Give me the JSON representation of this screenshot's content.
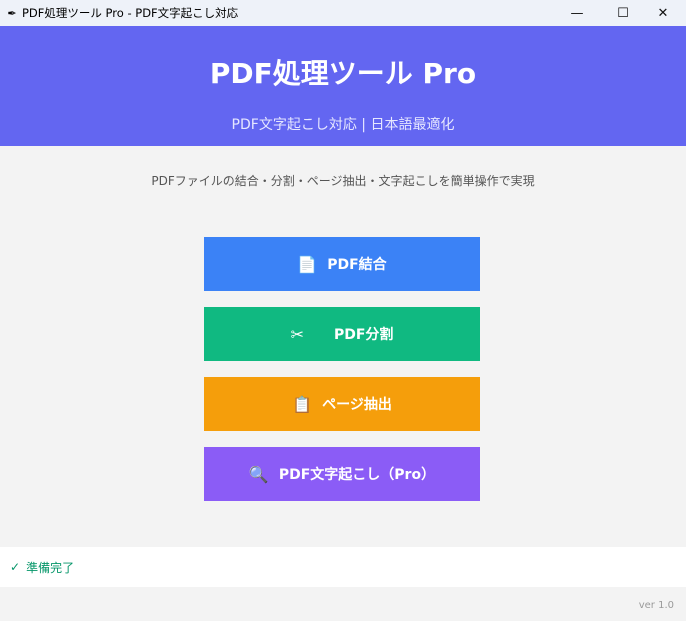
{
  "window": {
    "title": "PDF処理ツール Pro - PDF文字起こし対応",
    "icon": "feather-icon",
    "minimize": "—",
    "maximize": "☐",
    "close": "✕"
  },
  "header": {
    "title": "PDF処理ツール Pro",
    "subtitle": "PDF文字起こし対応 | 日本語最適化"
  },
  "description": "PDFファイルの結合・分割・ページ抽出・文字起こしを簡単操作で実現",
  "buttons": [
    {
      "label": "PDF結合",
      "icon": "📄",
      "color": "#3b82f6"
    },
    {
      "label": "PDF分割",
      "icon": "✂",
      "color": "#10b981"
    },
    {
      "label": "ページ抽出",
      "icon": "📋",
      "color": "#f59e0b"
    },
    {
      "label": "PDF文字起こし（Pro）",
      "icon": "🔍",
      "color": "#8b5cf6"
    }
  ],
  "status": {
    "icon": "✓",
    "text": "準備完了"
  },
  "version": "ver 1.0"
}
